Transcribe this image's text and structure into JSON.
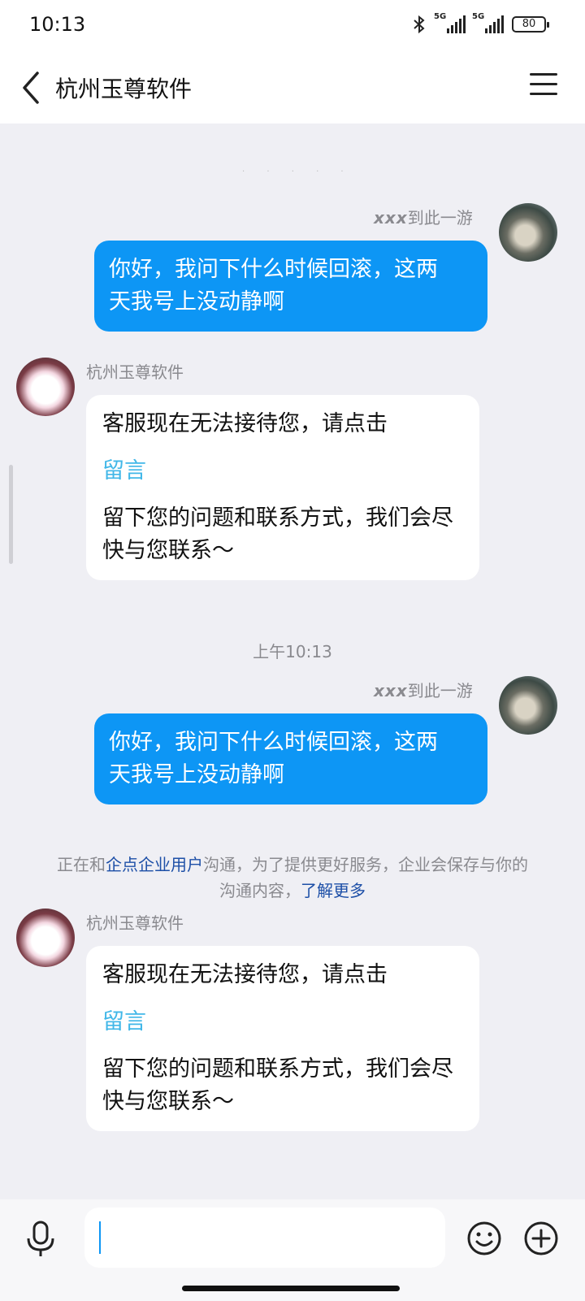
{
  "status_bar": {
    "time": "10:13",
    "network_1": "5G",
    "network_2": "5G",
    "battery": "80"
  },
  "header": {
    "title": "杭州玉尊软件",
    "back_icon": "chevron-left-icon",
    "menu_icon": "hamburger-icon"
  },
  "top_dots": "· · · · ·",
  "messages": [
    {
      "sender_prefix": "xxx",
      "sender_suffix": "到此一游",
      "line1": "你好，我问下什么时候回滚，这两",
      "line2": "天我号上没动静啊"
    },
    {
      "sender": "杭州玉尊软件",
      "text1": "客服现在无法接待您，请点击",
      "link": "留言",
      "text2a": "留下您的问题和联系方式，我们会尽",
      "text2b": "快与您联系～"
    },
    {
      "sender_prefix": "xxx",
      "sender_suffix": "到此一游",
      "line1": "你好，我问下什么时候回滚，这两",
      "line2": "天我号上没动静啊"
    },
    {
      "sender": "杭州玉尊软件",
      "text1": "客服现在无法接待您，请点击",
      "link": "留言",
      "text2a": "留下您的问题和联系方式，我们会尽",
      "text2b": "快与您联系～"
    }
  ],
  "timestamp": "上午10:13",
  "notice": {
    "part1": "正在和",
    "link1": "企点企业用户",
    "part2": "沟通，为了提供更好服务，企业会保存与你的",
    "part3": "沟通内容，",
    "link2": "了解更多"
  },
  "input_bar": {
    "mic_icon": "microphone-icon",
    "input_value": "",
    "emoji_icon": "smiley-icon",
    "plus_icon": "plus-circle-icon"
  },
  "colors": {
    "outgoing_bubble": "#0d96f5",
    "link": "#41b7e8",
    "notice_link": "#1d4fa7",
    "background": "#efeff4"
  }
}
